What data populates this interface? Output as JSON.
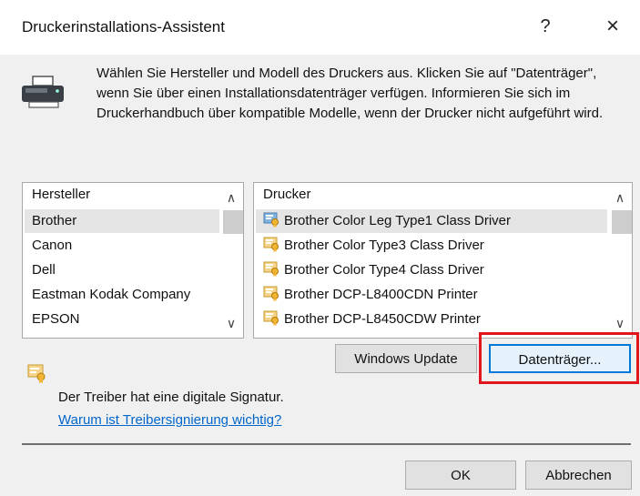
{
  "window": {
    "title": "Druckerinstallations-Assistent",
    "help_glyph": "?",
    "close_glyph": "×"
  },
  "header": {
    "instructions": "Wählen Sie Hersteller und Modell des Druckers aus. Klicken Sie auf \"Datenträger\", wenn Sie über einen Installationsdatenträger verfügen. Informieren Sie sich im Druckerhandbuch über kompatible Modelle, wenn der Drucker nicht aufgeführt wird.",
    "icon": "printer-icon"
  },
  "manufacturer_list": {
    "heading": "Hersteller",
    "items": [
      {
        "label": "Brother",
        "selected": true
      },
      {
        "label": "Canon",
        "selected": false
      },
      {
        "label": "Dell",
        "selected": false
      },
      {
        "label": "Eastman Kodak Company",
        "selected": false
      },
      {
        "label": "EPSON",
        "selected": false
      }
    ],
    "scroll_up": "∧",
    "scroll_down": "∨"
  },
  "printer_list": {
    "heading": "Drucker",
    "items": [
      {
        "label": "Brother Color Leg Type1 Class Driver",
        "selected": true
      },
      {
        "label": "Brother Color Type3 Class Driver",
        "selected": false
      },
      {
        "label": "Brother Color Type4 Class Driver",
        "selected": false
      },
      {
        "label": "Brother DCP-L8400CDN Printer",
        "selected": false
      },
      {
        "label": "Brother DCP-L8450CDW Printer",
        "selected": false
      }
    ],
    "scroll_up": "∧",
    "scroll_down": "∨"
  },
  "buttons": {
    "windows_update": "Windows Update",
    "datentraeger": "Datenträger...",
    "ok": "OK",
    "cancel": "Abbrechen"
  },
  "signature": {
    "text": "Der Treiber hat eine digitale Signatur.",
    "link": "Warum ist Treibersignierung wichtig?"
  },
  "colors": {
    "accent": "#0078d7",
    "highlight": "#e0161c",
    "link": "#0066cc"
  }
}
